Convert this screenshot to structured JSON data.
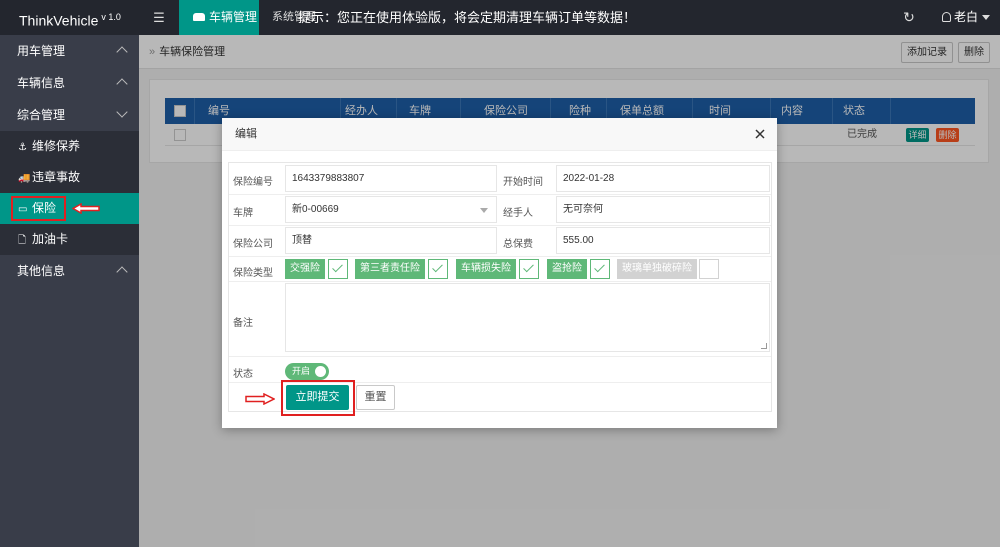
{
  "app": {
    "name": "ThinkVehicle",
    "version": "v 1.0"
  },
  "topbar": {
    "menu_toggle_glyph": "☰",
    "active_tab": "车辆管理",
    "tab_system": "系统管理",
    "notice": "提示：您正在使用体验版，将会定期清理车辆订单等数据！",
    "refresh_glyph": "↻",
    "user": "老白"
  },
  "sidebar": {
    "groups": [
      {
        "label": "用车管理",
        "expanded": false
      },
      {
        "label": "车辆信息",
        "expanded": false
      },
      {
        "label": "综合管理",
        "expanded": true
      },
      {
        "label": "其他信息",
        "expanded": false
      }
    ],
    "items": [
      {
        "label": "维修保养",
        "icon": "anchor-icon",
        "glyph": "⚓"
      },
      {
        "label": "违章事故",
        "icon": "truck-icon",
        "glyph": "🚚"
      },
      {
        "label": "保险",
        "icon": "card-icon",
        "glyph": "▭",
        "active": true
      },
      {
        "label": "加油卡",
        "icon": "document-icon",
        "glyph": "🗋"
      }
    ]
  },
  "content": {
    "breadcrumb_sep": "»",
    "breadcrumb": "车辆保险管理",
    "add_button": "添加记录",
    "delete_button": "删除",
    "table": {
      "columns": [
        "编号",
        "经办人",
        "车牌",
        "保险公司",
        "险种",
        "保单总额",
        "时间",
        "内容",
        "状态"
      ],
      "row": {
        "status": "已完成",
        "detail": "详细",
        "delete": "删除"
      }
    }
  },
  "modal": {
    "title": "编辑",
    "fields": {
      "policy_no_label": "保险编号",
      "policy_no": "1643379883807",
      "start_time_label": "开始时间",
      "start_time": "2022-01-28",
      "plate_label": "车牌",
      "plate": "新0-00669",
      "handler_label": "经手人",
      "handler": "无可奈何",
      "company_label": "保险公司",
      "company": "顶替",
      "premium_label": "总保费",
      "premium": "555.00",
      "type_label": "保险类型",
      "types": [
        {
          "label": "交强险",
          "checked": true
        },
        {
          "label": "第三者责任险",
          "checked": true
        },
        {
          "label": "车辆损失险",
          "checked": true
        },
        {
          "label": "盗抢险",
          "checked": true
        },
        {
          "label": "玻璃单独破碎险",
          "checked": false
        }
      ],
      "remark_label": "备注",
      "remark": "",
      "status_label": "状态",
      "status_switch": "开启"
    },
    "submit": "立即提交",
    "reset": "重置"
  },
  "colors": {
    "accent": "#009688",
    "checkbox_green": "#5fb878",
    "table_header": "#1e5fa8",
    "annotation_red": "#e02020"
  }
}
